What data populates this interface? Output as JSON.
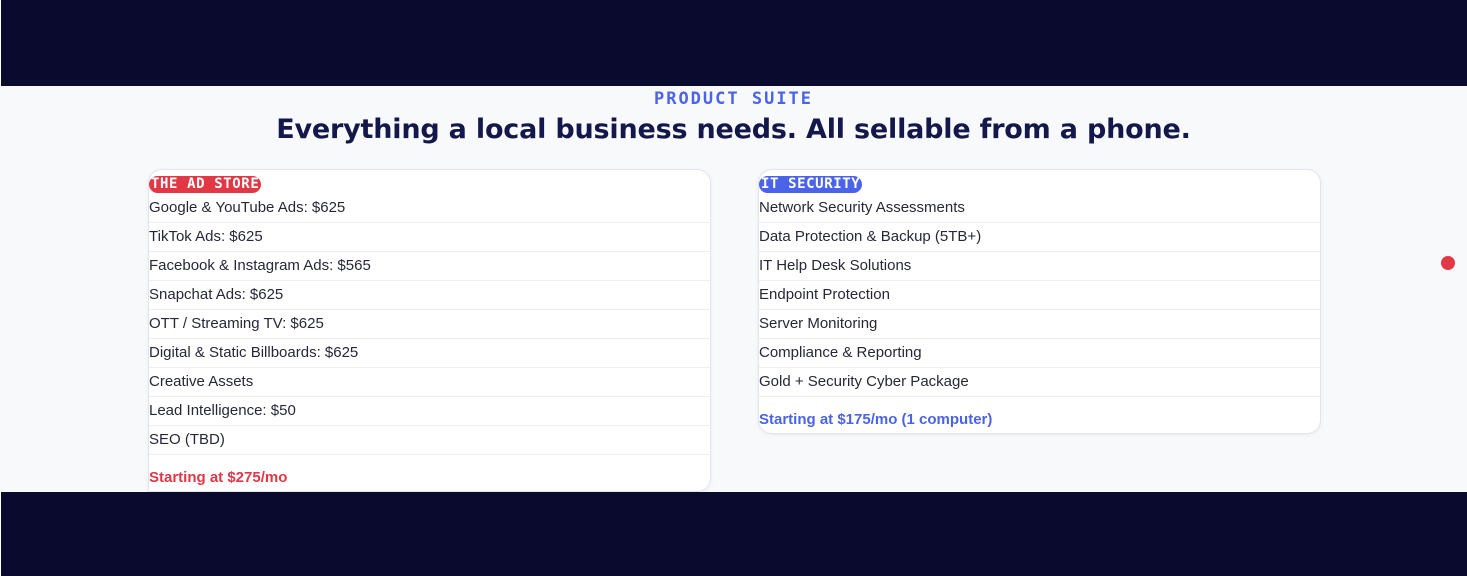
{
  "section": {
    "eyebrow": "PRODUCT SUITE",
    "headline": "Everything a local business needs. All sellable from a phone."
  },
  "cards": {
    "ad_store": {
      "badge": "THE AD STORE",
      "items": [
        "Google & YouTube Ads: $625",
        "TikTok Ads: $625",
        "Facebook & Instagram Ads: $565",
        "Snapchat Ads: $625",
        "OTT / Streaming TV: $625",
        "Digital & Static Billboards: $625",
        "Creative Assets",
        "Lead Intelligence: $50",
        "SEO (TBD)"
      ],
      "price": "Starting at $275/mo"
    },
    "it_security": {
      "badge": "IT SECURITY",
      "items": [
        "Network Security Assessments",
        "Data Protection & Backup (5TB+)",
        "IT Help Desk Solutions",
        "Endpoint Protection",
        "Server Monitoring",
        "Compliance & Reporting",
        "Gold + Security Cyber Package"
      ],
      "price": "Starting at $175/mo (1 computer)"
    }
  },
  "colors": {
    "navy": "#0a0a2e",
    "accent_blue": "#4a63e8",
    "accent_red": "#e23744",
    "heading": "#14174a"
  }
}
